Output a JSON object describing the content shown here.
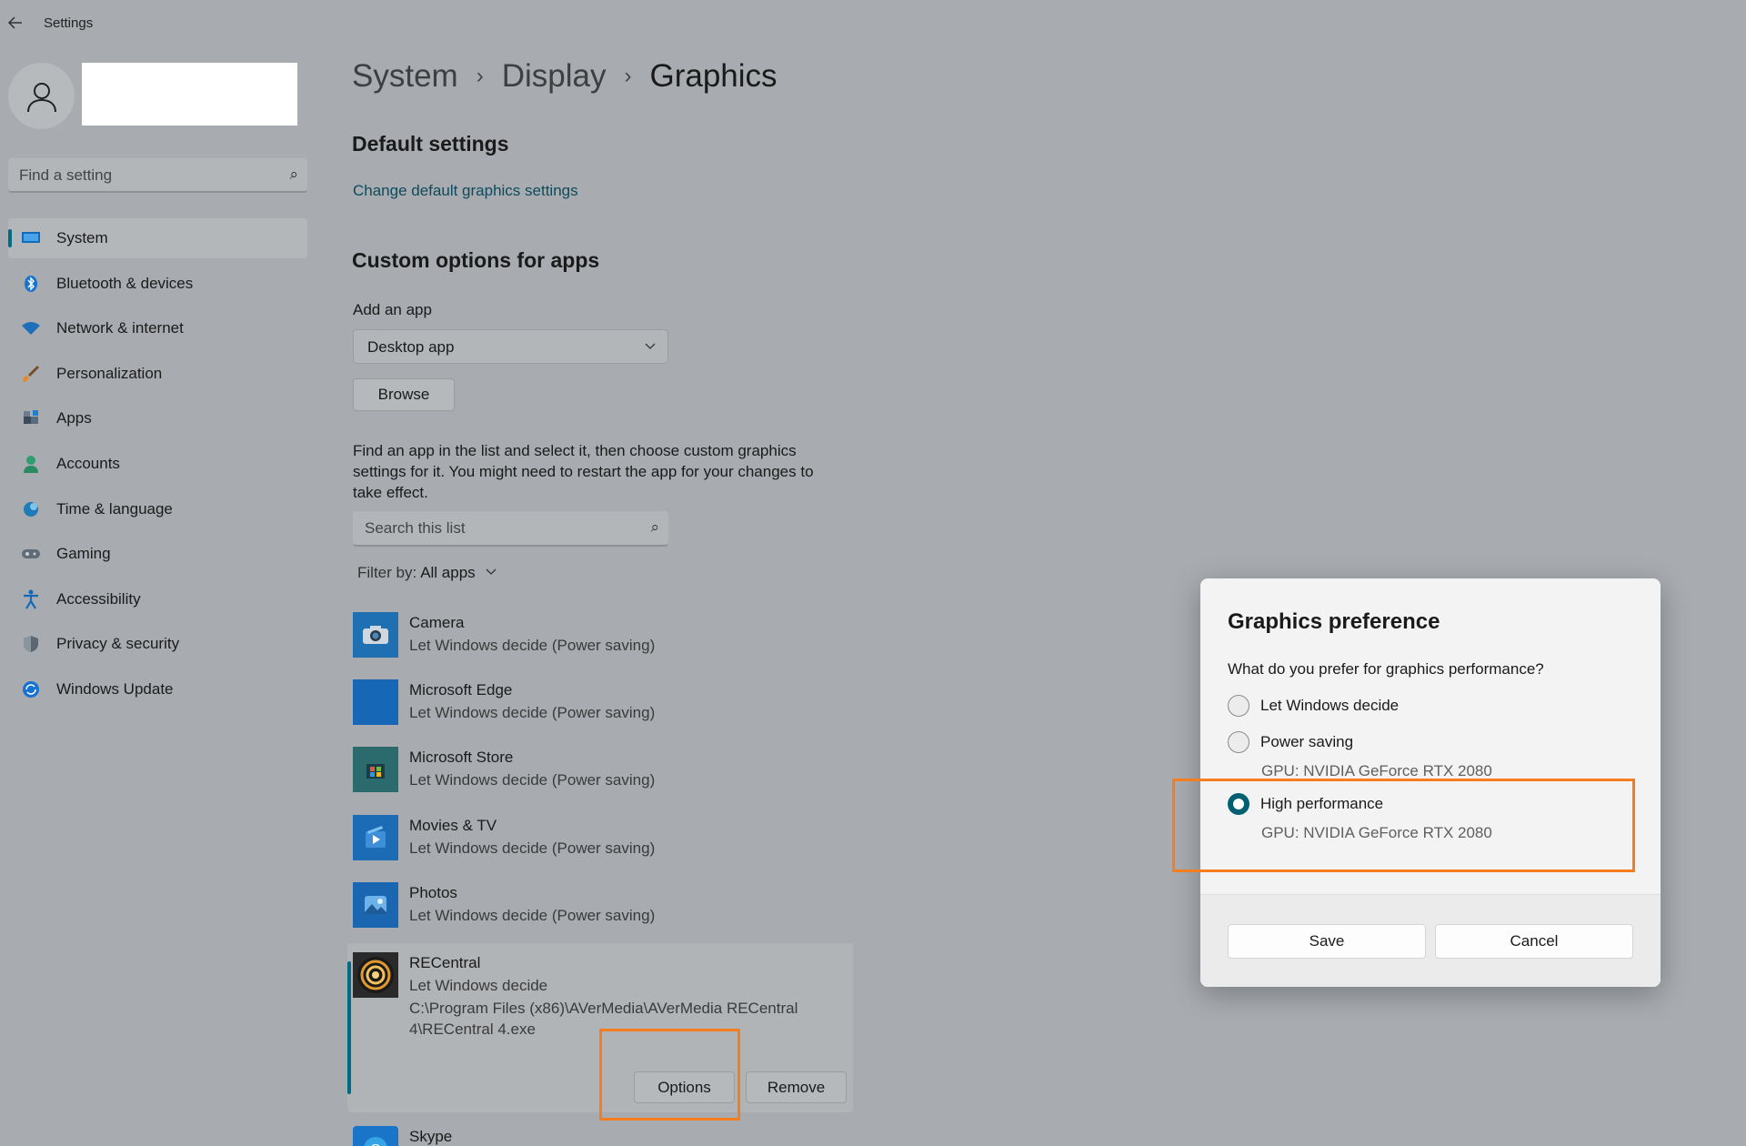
{
  "window": {
    "title": "Settings",
    "back_icon": "back-arrow-icon"
  },
  "sidebar": {
    "search_placeholder": "Find a setting",
    "items": [
      {
        "label": "System",
        "icon": "monitor-icon",
        "active": true
      },
      {
        "label": "Bluetooth & devices",
        "icon": "bluetooth-icon"
      },
      {
        "label": "Network & internet",
        "icon": "wifi-icon"
      },
      {
        "label": "Personalization",
        "icon": "brush-icon"
      },
      {
        "label": "Apps",
        "icon": "apps-icon"
      },
      {
        "label": "Accounts",
        "icon": "person-icon"
      },
      {
        "label": "Time & language",
        "icon": "globe-clock-icon"
      },
      {
        "label": "Gaming",
        "icon": "gamepad-icon"
      },
      {
        "label": "Accessibility",
        "icon": "accessibility-icon"
      },
      {
        "label": "Privacy & security",
        "icon": "shield-icon"
      },
      {
        "label": "Windows Update",
        "icon": "update-icon"
      }
    ]
  },
  "breadcrumb": [
    "System",
    "Display",
    "Graphics"
  ],
  "main": {
    "default_heading": "Default settings",
    "default_link": "Change default graphics settings",
    "custom_heading": "Custom options for apps",
    "add_app_label": "Add an app",
    "app_type_selected": "Desktop app",
    "browse_label": "Browse",
    "help_text": "Find an app in the list and select it, then choose custom graphics settings for it. You might need to restart the app for your changes to take effect.",
    "search_placeholder": "Search this list",
    "filter_label": "Filter by:",
    "filter_value": "All apps",
    "apps": [
      {
        "name": "Camera",
        "status": "Let Windows decide (Power saving)",
        "icon": "camera-icon"
      },
      {
        "name": "Microsoft Edge",
        "status": "Let Windows decide (Power saving)",
        "icon": "edge-icon"
      },
      {
        "name": "Microsoft Store",
        "status": "Let Windows decide (Power saving)",
        "icon": "store-icon"
      },
      {
        "name": "Movies & TV",
        "status": "Let Windows decide (Power saving)",
        "icon": "movies-icon"
      },
      {
        "name": "Photos",
        "status": "Let Windows decide (Power saving)",
        "icon": "photos-icon"
      }
    ],
    "expanded_app": {
      "name": "RECentral",
      "status": "Let Windows decide",
      "path": "C:\\Program Files (x86)\\AVerMedia\\AVerMedia RECentral 4\\RECentral 4.exe",
      "options_label": "Options",
      "remove_label": "Remove"
    },
    "partial_app": {
      "name": "Skype"
    }
  },
  "dialog": {
    "title": "Graphics preference",
    "question": "What do you prefer for graphics performance?",
    "options": [
      {
        "label": "Let Windows decide",
        "checked": false
      },
      {
        "label": "Power saving",
        "gpu": "GPU: NVIDIA GeForce RTX 2080",
        "checked": false
      },
      {
        "label": "High performance",
        "gpu": "GPU: NVIDIA GeForce RTX 2080",
        "checked": true
      }
    ],
    "save_label": "Save",
    "cancel_label": "Cancel"
  },
  "colors": {
    "accent": "#006b82",
    "highlight": "#f57c1f",
    "link": "#0d4b5c"
  }
}
